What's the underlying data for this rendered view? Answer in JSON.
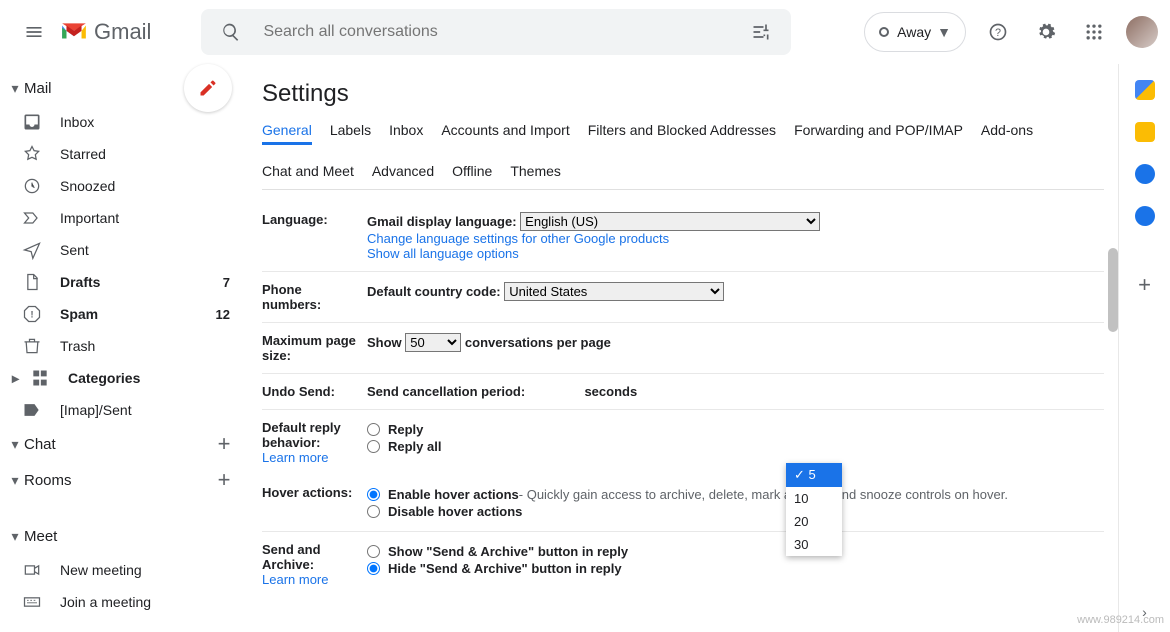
{
  "header": {
    "logo_text": "Gmail",
    "search_placeholder": "Search all conversations",
    "status_label": "Away"
  },
  "sidebar": {
    "mail_label": "Mail",
    "items": [
      {
        "label": "Inbox",
        "bold": false,
        "count": ""
      },
      {
        "label": "Starred",
        "bold": false,
        "count": ""
      },
      {
        "label": "Snoozed",
        "bold": false,
        "count": ""
      },
      {
        "label": "Important",
        "bold": false,
        "count": ""
      },
      {
        "label": "Sent",
        "bold": false,
        "count": ""
      },
      {
        "label": "Drafts",
        "bold": true,
        "count": "7"
      },
      {
        "label": "Spam",
        "bold": true,
        "count": "12"
      },
      {
        "label": "Trash",
        "bold": false,
        "count": ""
      },
      {
        "label": "Categories",
        "bold": true,
        "count": ""
      },
      {
        "label": "[Imap]/Sent",
        "bold": false,
        "count": ""
      }
    ],
    "chat_label": "Chat",
    "rooms_label": "Rooms",
    "meet_label": "Meet",
    "new_meeting": "New meeting",
    "join_meeting": "Join a meeting"
  },
  "settings": {
    "title": "Settings",
    "tabs": [
      "General",
      "Labels",
      "Inbox",
      "Accounts and Import",
      "Filters and Blocked Addresses",
      "Forwarding and POP/IMAP",
      "Add-ons",
      "Chat and Meet",
      "Advanced",
      "Offline",
      "Themes"
    ],
    "language": {
      "row_label": "Language:",
      "display_label": "Gmail display language:",
      "selected": "English (US)",
      "change_link": "Change language settings for other Google products",
      "show_all": "Show all language options"
    },
    "phone": {
      "row_label": "Phone numbers:",
      "default_label": "Default country code:",
      "selected": "United States"
    },
    "pagesize": {
      "row_label": "Maximum page size:",
      "show": "Show",
      "selected": "50",
      "suffix": "conversations per page"
    },
    "undo": {
      "row_label": "Undo Send:",
      "period_label": "Send cancellation period:",
      "suffix": "seconds",
      "options": [
        "5",
        "10",
        "20",
        "30"
      ],
      "selected": "5"
    },
    "reply": {
      "row_label": "Default reply behavior:",
      "learn_more": "Learn more",
      "opt1": "Reply",
      "opt2": "Reply all"
    },
    "hover": {
      "row_label": "Hover actions:",
      "opt1": "Enable hover actions",
      "opt1_desc": " - Quickly gain access to archive, delete, mark as read, and snooze controls on hover.",
      "opt2": "Disable hover actions"
    },
    "send_archive": {
      "row_label": "Send and Archive:",
      "learn_more": "Learn more",
      "opt1": "Show \"Send & Archive\" button in reply",
      "opt2": "Hide \"Send & Archive\" button in reply"
    }
  },
  "watermark": "www.989214.com"
}
